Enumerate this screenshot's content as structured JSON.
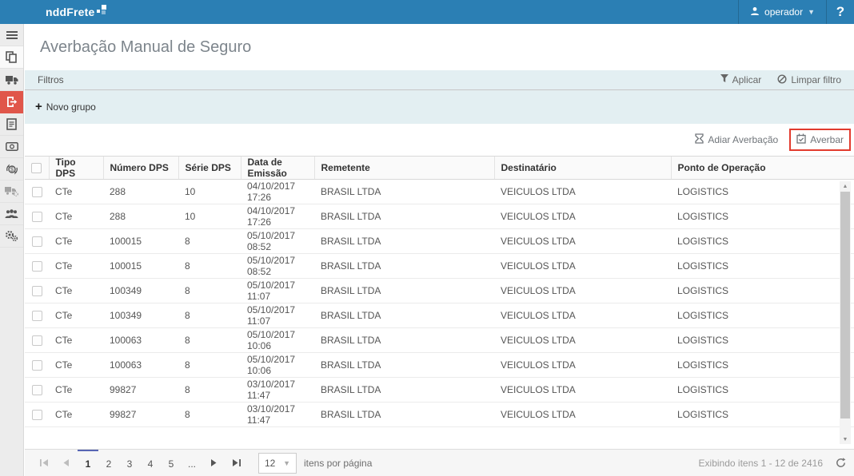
{
  "topbar": {
    "logo_text": "nddFrete",
    "user_label": "operador",
    "help_label": "?"
  },
  "sidebar": {
    "items": [
      {
        "icon": "hamburger-icon"
      },
      {
        "icon": "copy-icon"
      },
      {
        "icon": "truck-icon"
      },
      {
        "icon": "export-document-icon",
        "active": true
      },
      {
        "icon": "document-icon"
      },
      {
        "icon": "banknote-icon"
      },
      {
        "icon": "currency-exchange-icon"
      },
      {
        "icon": "truck-gear-icon"
      },
      {
        "icon": "users-icon"
      },
      {
        "icon": "gears-icon"
      }
    ]
  },
  "page": {
    "title": "Averbação Manual de Seguro"
  },
  "filters": {
    "title": "Filtros",
    "apply_label": "Aplicar",
    "clear_label": "Limpar filtro",
    "new_group_label": "Novo grupo"
  },
  "actions": {
    "postpone_label": "Adiar Averbação",
    "endorse_label": "Averbar"
  },
  "table": {
    "columns": [
      "Tipo DPS",
      "Número DPS",
      "Série DPS",
      "Data de Emissão",
      "Remetente",
      "Destinatário",
      "Ponto de Operação"
    ],
    "rows": [
      {
        "tipo": "CTe",
        "numero": "288",
        "serie": "10",
        "data": "04/10/2017 17:26",
        "remetente": "BRASIL LTDA",
        "destinatario": "VEICULOS LTDA",
        "ponto": "LOGISTICS"
      },
      {
        "tipo": "CTe",
        "numero": "288",
        "serie": "10",
        "data": "04/10/2017 17:26",
        "remetente": "BRASIL LTDA",
        "destinatario": "VEICULOS LTDA",
        "ponto": "LOGISTICS"
      },
      {
        "tipo": "CTe",
        "numero": "100015",
        "serie": "8",
        "data": "05/10/2017 08:52",
        "remetente": "BRASIL LTDA",
        "destinatario": "VEICULOS LTDA",
        "ponto": "LOGISTICS"
      },
      {
        "tipo": "CTe",
        "numero": "100015",
        "serie": "8",
        "data": "05/10/2017 08:52",
        "remetente": "BRASIL LTDA",
        "destinatario": "VEICULOS LTDA",
        "ponto": "LOGISTICS"
      },
      {
        "tipo": "CTe",
        "numero": "100349",
        "serie": "8",
        "data": "05/10/2017 11:07",
        "remetente": "BRASIL LTDA",
        "destinatario": "VEICULOS LTDA",
        "ponto": "LOGISTICS"
      },
      {
        "tipo": "CTe",
        "numero": "100349",
        "serie": "8",
        "data": "05/10/2017 11:07",
        "remetente": "BRASIL LTDA",
        "destinatario": "VEICULOS LTDA",
        "ponto": "LOGISTICS"
      },
      {
        "tipo": "CTe",
        "numero": "100063",
        "serie": "8",
        "data": "05/10/2017 10:06",
        "remetente": "BRASIL LTDA",
        "destinatario": "VEICULOS LTDA",
        "ponto": "LOGISTICS"
      },
      {
        "tipo": "CTe",
        "numero": "100063",
        "serie": "8",
        "data": "05/10/2017 10:06",
        "remetente": "BRASIL LTDA",
        "destinatario": "VEICULOS LTDA",
        "ponto": "LOGISTICS"
      },
      {
        "tipo": "CTe",
        "numero": "99827",
        "serie": "8",
        "data": "03/10/2017 11:47",
        "remetente": "BRASIL LTDA",
        "destinatario": "VEICULOS LTDA",
        "ponto": "LOGISTICS"
      },
      {
        "tipo": "CTe",
        "numero": "99827",
        "serie": "8",
        "data": "03/10/2017 11:47",
        "remetente": "BRASIL LTDA",
        "destinatario": "VEICULOS LTDA",
        "ponto": "LOGISTICS"
      }
    ]
  },
  "pagination": {
    "pages": [
      "1",
      "2",
      "3",
      "4",
      "5",
      "..."
    ],
    "current": "1",
    "page_size": "12",
    "page_size_label": "itens por página",
    "status": "Exibindo itens 1 - 12 de 2416"
  },
  "colors": {
    "topbar": "#2b7fb4",
    "sidebar_active": "#e0564a",
    "annotation_box": "#e23b2e",
    "filters_bg": "#e3eff2",
    "active_page_indicator": "#5766b4"
  }
}
